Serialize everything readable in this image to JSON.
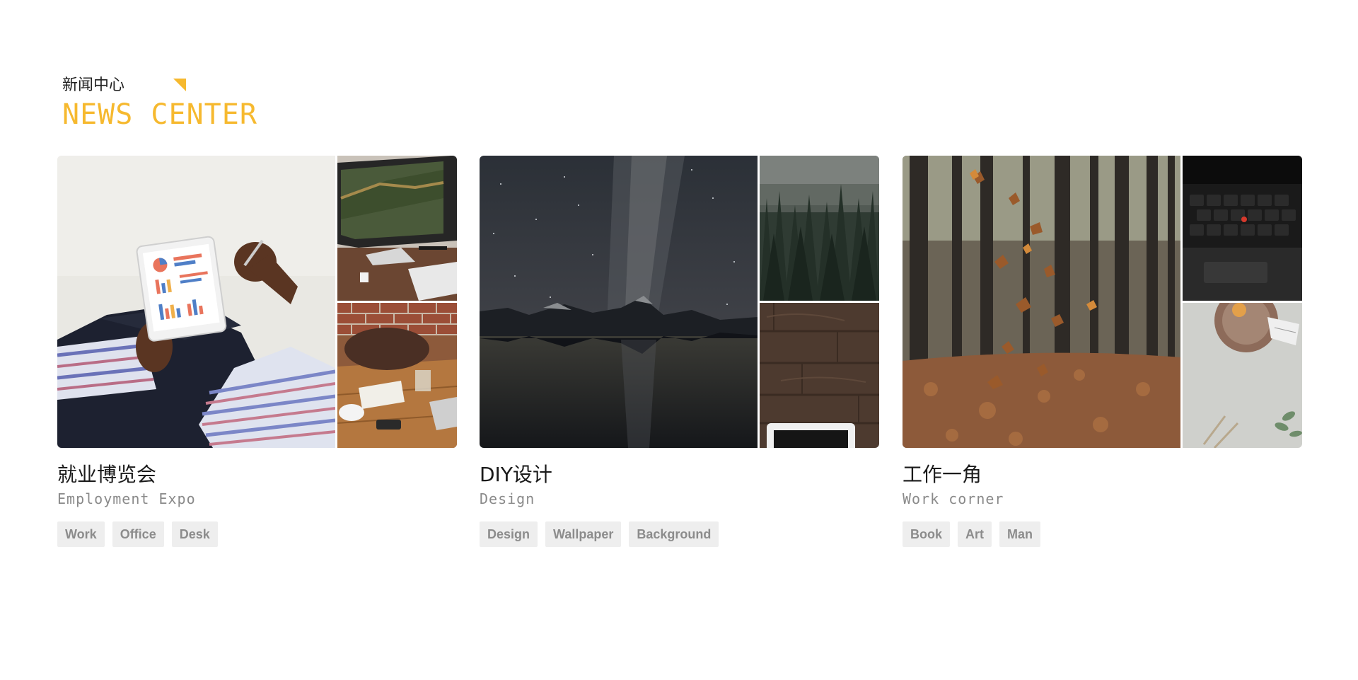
{
  "header": {
    "subtitle_cn": "新闻中心",
    "title_en": "NEWS CENTER",
    "accent_color": "#f6b92f"
  },
  "cards": [
    {
      "title": "就业博览会",
      "subtitle": "Employment Expo",
      "tags": [
        "Work",
        "Office",
        "Desk"
      ]
    },
    {
      "title": "DIY设计",
      "subtitle": "Design",
      "tags": [
        "Design",
        "Wallpaper",
        "Background"
      ]
    },
    {
      "title": "工作一角",
      "subtitle": "Work corner",
      "tags": [
        "Book",
        "Art",
        "Man"
      ]
    }
  ],
  "colors": {
    "tag_background": "#eeeeee",
    "tag_text": "#8c8c8c",
    "title_text": "#1a1a1a",
    "subtitle_text": "#8a8a8a"
  }
}
